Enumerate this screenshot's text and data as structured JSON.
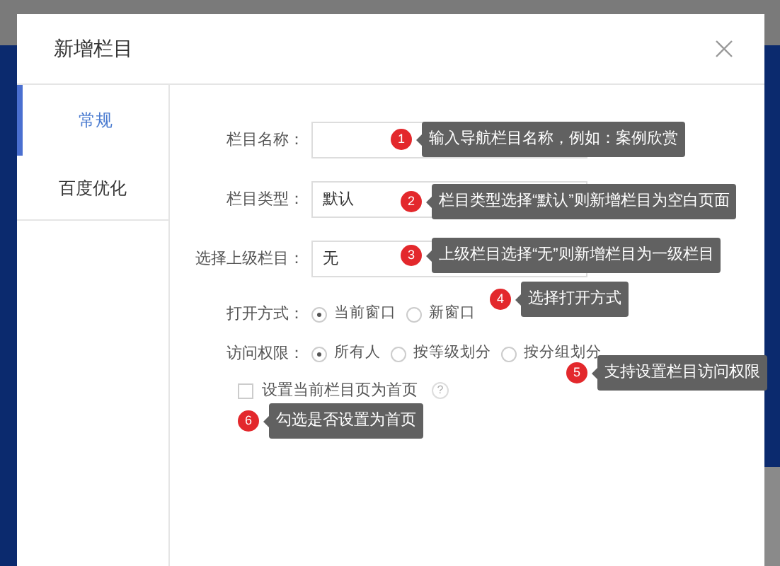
{
  "dialog": {
    "title": "新增栏目"
  },
  "tabs": [
    {
      "label": "常规",
      "selected": true
    },
    {
      "label": "百度优化",
      "selected": false
    }
  ],
  "fields": [
    {
      "label": "栏目名称："
    },
    {
      "label": "栏目类型：",
      "value": "默认"
    },
    {
      "label": "选择上级栏目：",
      "value": "无"
    }
  ],
  "radio_groups": [
    {
      "label": "打开方式：",
      "options": [
        {
          "label": "当前窗口",
          "selected": true
        },
        {
          "label": "新窗口",
          "selected": false
        }
      ]
    },
    {
      "label": "访问权限：",
      "options": [
        {
          "label": "所有人",
          "selected": true
        },
        {
          "label": "按等级划分",
          "selected": false
        },
        {
          "label": "按分组划分",
          "selected": false
        }
      ]
    }
  ],
  "homepage_checkbox": {
    "label": "设置当前栏目页为首页",
    "checked": false,
    "help": "?"
  },
  "annotations": [
    {
      "number": "1",
      "text": "输入导航栏目名称，例如：案例欣赏"
    },
    {
      "number": "2",
      "text": "栏目类型选择“默认”则新增栏目为空白页面"
    },
    {
      "number": "3",
      "text": "上级栏目选择“无”则新增栏目为一级栏目"
    },
    {
      "number": "4",
      "text": "选择打开方式"
    },
    {
      "number": "5",
      "text": "支持设置栏目访问权限"
    },
    {
      "number": "6",
      "text": "勾选是否设置为首页"
    }
  ]
}
